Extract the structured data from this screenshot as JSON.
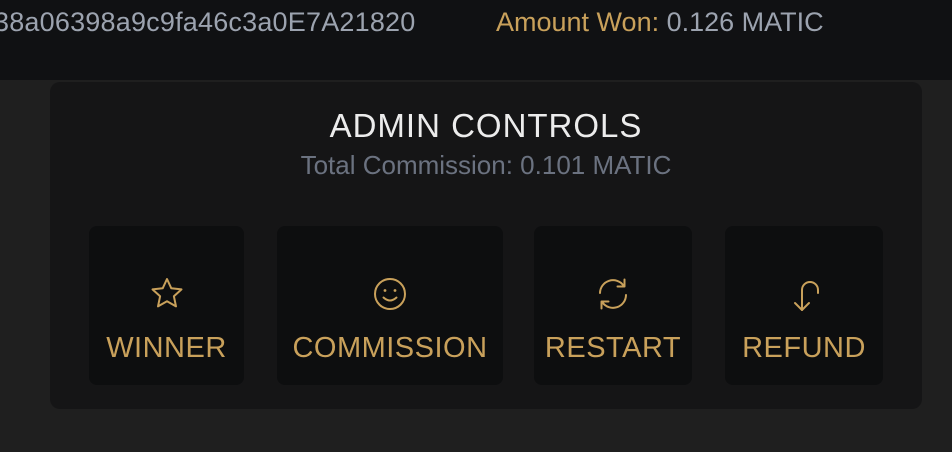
{
  "header": {
    "address": "38a06398a9c9fa46c3a0E7A21820",
    "amount_won_label": "Amount Won:",
    "amount_won_value": "0.126 MATIC"
  },
  "admin": {
    "title": "ADMIN CONTROLS",
    "commission_text": "Total Commission: 0.101 MATIC",
    "buttons": [
      {
        "label": "WINNER",
        "icon": "star-icon"
      },
      {
        "label": "COMMISSION",
        "icon": "smile-icon"
      },
      {
        "label": "RESTART",
        "icon": "refresh-icon"
      },
      {
        "label": "REFUND",
        "icon": "refund-arrow-icon"
      }
    ]
  },
  "colors": {
    "accent": "#c9a15b",
    "muted": "#9ca3af",
    "background": "#1f1f1f",
    "panel": "#151516",
    "button": "#0d0e0f"
  }
}
